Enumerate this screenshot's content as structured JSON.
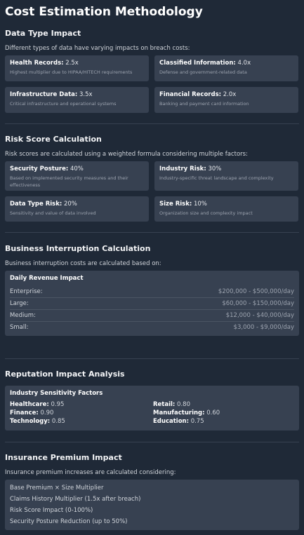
{
  "title": "Cost Estimation Methodology",
  "data_type": {
    "heading": "Data Type Impact",
    "desc": "Different types of data have varying impacts on breach costs:",
    "cards": [
      {
        "label": "Health Records:",
        "value": "2.5x",
        "sub": "Highest multiplier due to HIPAA/HITECH requirements"
      },
      {
        "label": "Classified Information:",
        "value": "4.0x",
        "sub": "Defense and government-related data"
      },
      {
        "label": "Infrastructure Data:",
        "value": "3.5x",
        "sub": "Critical infrastructure and operational systems"
      },
      {
        "label": "Financial Records:",
        "value": "2.0x",
        "sub": "Banking and payment card information"
      }
    ]
  },
  "risk_score": {
    "heading": "Risk Score Calculation",
    "desc": "Risk scores are calculated using a weighted formula considering multiple factors:",
    "cards": [
      {
        "label": "Security Posture:",
        "value": "40%",
        "sub": "Based on implemented security measures and their effectiveness"
      },
      {
        "label": "Industry Risk:",
        "value": "30%",
        "sub": "Industry-specific threat landscape and complexity"
      },
      {
        "label": "Data Type Risk:",
        "value": "20%",
        "sub": "Sensitivity and value of data involved"
      },
      {
        "label": "Size Risk:",
        "value": "10%",
        "sub": "Organization size and complexity impact"
      }
    ]
  },
  "business": {
    "heading": "Business Interruption Calculation",
    "desc": "Business interruption costs are calculated based on:",
    "box_title": "Daily Revenue Impact",
    "rows": [
      {
        "name": "Enterprise:",
        "value": "$200,000 - $500,000/day"
      },
      {
        "name": "Large:",
        "value": "$60,000 - $150,000/day"
      },
      {
        "name": "Medium:",
        "value": "$12,000 - $40,000/day"
      },
      {
        "name": "Small:",
        "value": "$3,000 - $9,000/day"
      }
    ]
  },
  "reputation": {
    "heading": "Reputation Impact Analysis",
    "box_title": "Industry Sensitivity Factors",
    "factors": [
      {
        "label": "Healthcare:",
        "value": "0.95"
      },
      {
        "label": "Retail:",
        "value": "0.80"
      },
      {
        "label": "Finance:",
        "value": "0.90"
      },
      {
        "label": "Manufacturing:",
        "value": "0.60"
      },
      {
        "label": "Technology:",
        "value": "0.85"
      },
      {
        "label": "Education:",
        "value": "0.75"
      }
    ]
  },
  "insurance": {
    "heading": "Insurance Premium Impact",
    "desc": "Insurance premium increases are calculated considering:",
    "lines": [
      "Base Premium × Size Multiplier",
      "Claims History Multiplier (1.5x after breach)",
      "Risk Score Impact (0-100%)",
      "Security Posture Reduction (up to 50%)"
    ]
  }
}
